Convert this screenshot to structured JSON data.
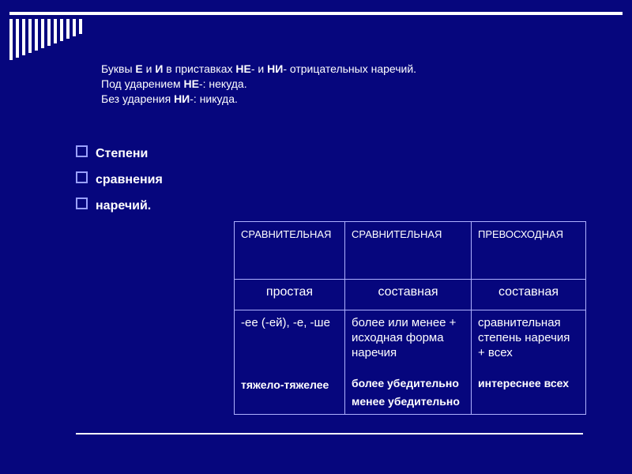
{
  "title": {
    "line1_pre": "Буквы ",
    "line1_b1": "Е",
    "line1_mid1": " и ",
    "line1_b2": "И",
    "line1_mid2": " в приставках ",
    "line1_b3": "НЕ",
    "line1_mid3": "- и ",
    "line1_b4": "НИ",
    "line1_post": "- отрицательных наречий.",
    "line2_pre": "Под ударением ",
    "line2_b": "НЕ",
    "line2_post": "-: некуда.",
    "line3_pre": "Без ударения ",
    "line3_b": "НИ",
    "line3_post": "-: никуда."
  },
  "bullets": [
    "Степени",
    "сравнения",
    "наречий."
  ],
  "table": {
    "headers": [
      "СРАВНИТЕЛЬНАЯ",
      "СРАВНИТЕЛЬНАЯ",
      "ПРЕВОСХОДНАЯ"
    ],
    "sub": [
      "простая",
      "составная",
      "составная"
    ],
    "cells": [
      {
        "desc": "-ее (-ей), -е, -ше",
        "examples": [
          "тяжело-тяжелее"
        ]
      },
      {
        "desc": "более или менее + исходная форма наречия",
        "examples": [
          "более убедительно",
          "менее убедительно"
        ]
      },
      {
        "desc": "сравнительная степень наречия + всех",
        "examples": [
          "интереснее всех"
        ]
      }
    ]
  }
}
